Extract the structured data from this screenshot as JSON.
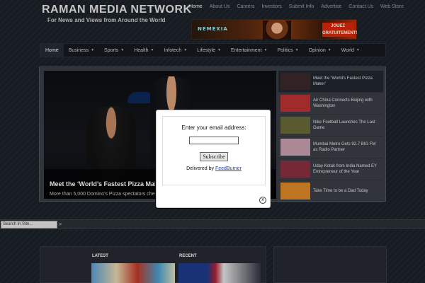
{
  "site": {
    "title": "RAMAN MEDIA NETWORK",
    "tagline": "For News and Views from Around the World"
  },
  "top_nav": [
    "Home",
    "About Us",
    "Careers",
    "Investors",
    "Submit Info",
    "Advertise",
    "Contact Us",
    "Web Store"
  ],
  "banner": {
    "logo": "NEMEXIA",
    "cta": "JOUEZ GRATUITEMENT!"
  },
  "main_nav": [
    {
      "label": "Home",
      "dropdown": false
    },
    {
      "label": "Business",
      "dropdown": true
    },
    {
      "label": "Sports",
      "dropdown": true
    },
    {
      "label": "Health",
      "dropdown": true
    },
    {
      "label": "Infotech",
      "dropdown": true
    },
    {
      "label": "Lifestyle",
      "dropdown": true
    },
    {
      "label": "Entertainment",
      "dropdown": true
    },
    {
      "label": "Politics",
      "dropdown": true
    },
    {
      "label": "Opinion",
      "dropdown": true
    },
    {
      "label": "World",
      "dropdown": true
    }
  ],
  "slider": {
    "title": "Meet the ‘World’s Fastest Pizza Mak",
    "excerpt": "More than 5,000 Domino’s Pizza spectators che",
    "items": [
      {
        "label": "Meet the ‘World’s Fastest Pizza Maker’",
        "thumb_color": "#3a2a2a"
      },
      {
        "label": "Air China Connects Beijing with Washington",
        "thumb_color": "#b33"
      },
      {
        "label": "Nike Football Launches The Last Game",
        "thumb_color": "#6a6a3a"
      },
      {
        "label": "Mumbai Metro Gets 92.7 BIG FM as Radio Partner",
        "thumb_color": "#c9a0b0"
      },
      {
        "label": "Uday Kotak from India Named EY Entrepreneur of the Year",
        "thumb_color": "#8a3040"
      },
      {
        "label": "Take Time to be a Dad Today",
        "thumb_color": "#e08a2a"
      }
    ]
  },
  "search": {
    "placeholder": "Search in Site...",
    "icon": "magnifier-icon"
  },
  "sections": {
    "latest": "LATEST",
    "recent": "RECENT"
  },
  "modal": {
    "label": "Enter your email address:",
    "email_value": "",
    "subscribe_label": "Subscribe",
    "delivered_prefix": "Delivered by ",
    "delivered_link": "FeedBurner",
    "close_symbol": "x"
  }
}
